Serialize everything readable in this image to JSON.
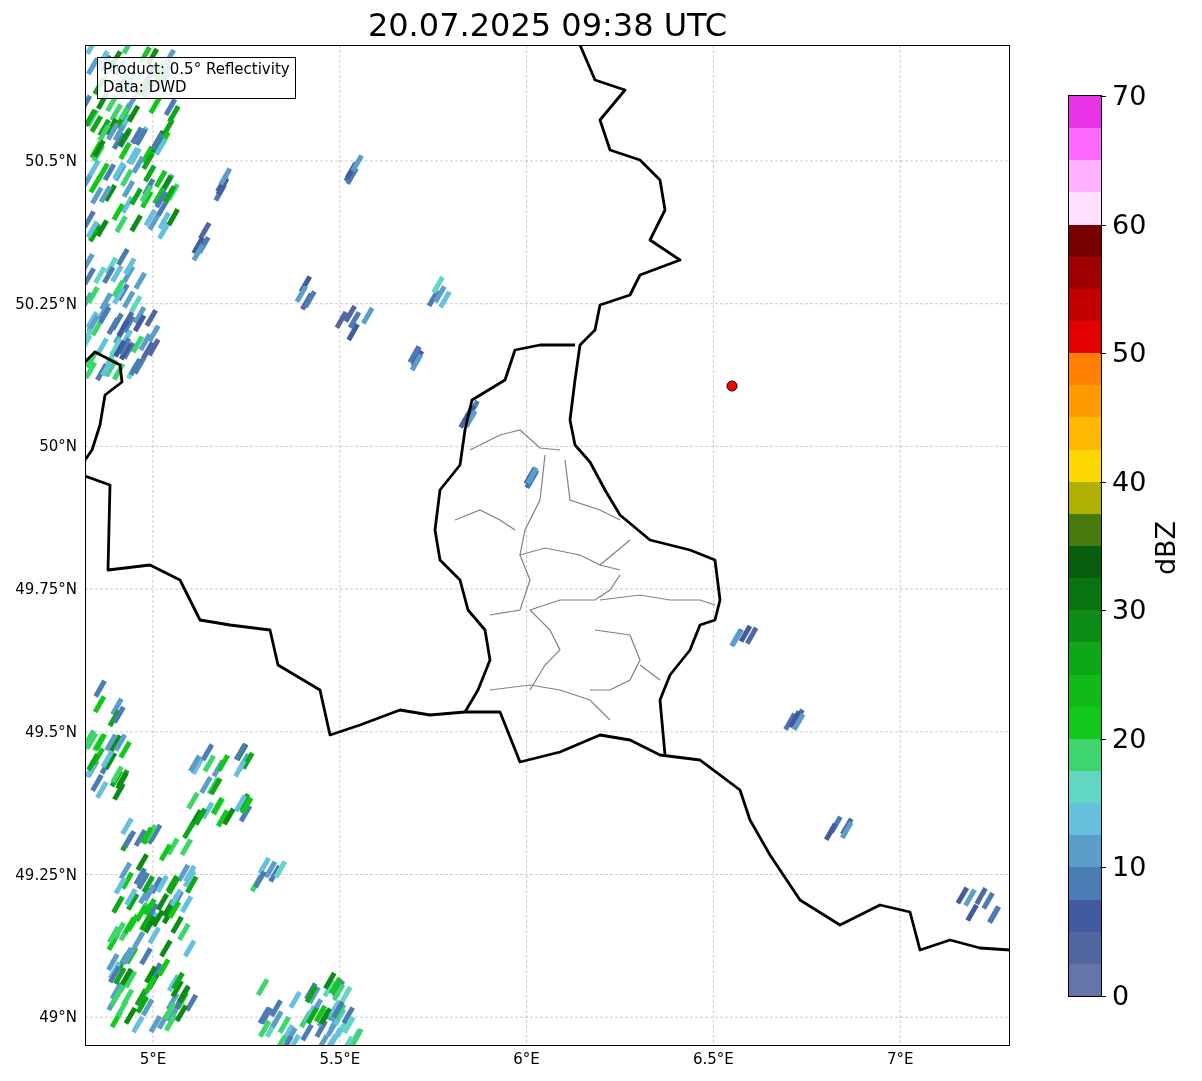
{
  "title": "20.07.2025 09:38 UTC",
  "legend": [
    "Product: 0.5° Reflectivity",
    "Data: DWD"
  ],
  "map": {
    "y_ticks": [
      "50.5°N",
      "50.25°N",
      "50°N",
      "49.75°N",
      "49.5°N",
      "49.25°N",
      "49°N"
    ],
    "x_ticks": [
      "5°E",
      "5.5°E",
      "6°E",
      "6.5°E",
      "7°E"
    ]
  },
  "colorbar": {
    "label": "dBZ",
    "ticks": [
      "70",
      "60",
      "50",
      "40",
      "30",
      "20",
      "10",
      "0"
    ],
    "bins": [
      {
        "color": "#6575a8"
      },
      {
        "color": "#52679f"
      },
      {
        "color": "#425ba0"
      },
      {
        "color": "#4b7cb4"
      },
      {
        "color": "#5b9ec8"
      },
      {
        "color": "#66c1de"
      },
      {
        "color": "#62d6c4"
      },
      {
        "color": "#3dd56c"
      },
      {
        "color": "#12c91b"
      },
      {
        "color": "#11b919"
      },
      {
        "color": "#0ea717"
      },
      {
        "color": "#0c8c14"
      },
      {
        "color": "#0a7412"
      },
      {
        "color": "#085e0f"
      },
      {
        "color": "#477a0c"
      },
      {
        "color": "#b0b004"
      },
      {
        "color": "#ffd700"
      },
      {
        "color": "#ffb800"
      },
      {
        "color": "#ff9b00"
      },
      {
        "color": "#ff8000"
      },
      {
        "color": "#e30000"
      },
      {
        "color": "#c20000"
      },
      {
        "color": "#a00000"
      },
      {
        "color": "#7a0000"
      },
      {
        "color": "#ffe0ff"
      },
      {
        "color": "#ffb0ff"
      },
      {
        "color": "#ff68ff"
      },
      {
        "color": "#e832e8"
      }
    ]
  }
}
